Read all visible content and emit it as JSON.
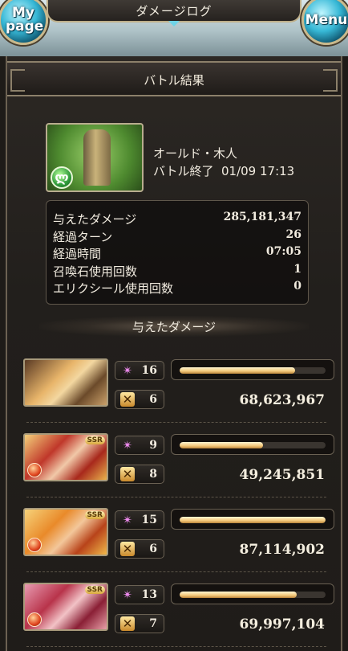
{
  "topbar": {
    "title": "ダメージログ",
    "mypage_label": "My page",
    "menu_label": "Menu"
  },
  "header": {
    "title": "バトル結果"
  },
  "enemy": {
    "name": "オールド・木人",
    "status": "バトル終了",
    "timestamp": "01/09 17:13",
    "element_icon": "wind-element-icon"
  },
  "summary": [
    {
      "label": "与えたダメージ",
      "value": "285,181,347"
    },
    {
      "label": "経過ターン",
      "value": "26"
    },
    {
      "label": "経過時間",
      "value": "07:05"
    },
    {
      "label": "召喚石使用回数",
      "value": "1"
    },
    {
      "label": "エリクシール使用回数",
      "value": "0"
    }
  ],
  "section": {
    "title": "与えたダメージ"
  },
  "characters": [
    {
      "skill_count": "16",
      "ca_count": "6",
      "damage": "68,623,967",
      "bar_fraction": 0.79,
      "rarity": "",
      "element": ""
    },
    {
      "skill_count": "9",
      "ca_count": "8",
      "damage": "49,245,851",
      "bar_fraction": 0.57,
      "rarity": "SSR",
      "element": "fire"
    },
    {
      "skill_count": "15",
      "ca_count": "6",
      "damage": "87,114,902",
      "bar_fraction": 1.0,
      "rarity": "SSR",
      "element": "fire"
    },
    {
      "skill_count": "13",
      "ca_count": "7",
      "damage": "69,997,104",
      "bar_fraction": 0.8,
      "rarity": "SSR",
      "element": "fire"
    }
  ],
  "icons": {
    "skill": "sparkle-icon",
    "ca": "charge-attack-icon"
  },
  "colors": {
    "accent_gold": "#f2c779",
    "panel": "#221f1c",
    "orb": "#37b8d6"
  }
}
